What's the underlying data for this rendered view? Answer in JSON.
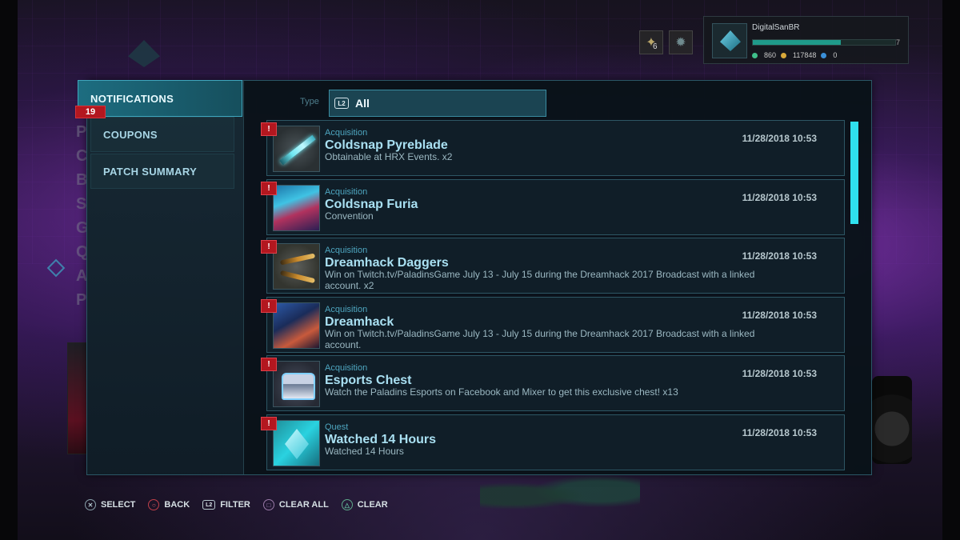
{
  "hud": {
    "badge_count": "6",
    "username": "DigitalSanBR",
    "level": "7",
    "xp_progress": 0.62,
    "stat_a": "860",
    "stat_b": "117848",
    "stat_c": "0"
  },
  "sidebar": {
    "items": [
      {
        "label": "NOTIFICATIONS"
      },
      {
        "label": "COUPONS"
      },
      {
        "label": "PATCH SUMMARY"
      }
    ],
    "notification_count": "19"
  },
  "filter": {
    "type_label": "Type",
    "l2": "L2",
    "value": "All"
  },
  "alert_glyph": "!",
  "notifications": [
    {
      "category": "Acquisition",
      "title": "Coldsnap Pyreblade",
      "desc": "Obtainable at HRX Events. x2",
      "date": "11/28/2018 10:53"
    },
    {
      "category": "Acquisition",
      "title": "Coldsnap Furia",
      "desc": "Convention",
      "date": "11/28/2018 10:53"
    },
    {
      "category": "Acquisition",
      "title": "Dreamhack Daggers",
      "desc": "Win on Twitch.tv/PaladinsGame July 13 - July 15 during the Dreamhack 2017 Broadcast with a linked account. x2",
      "date": "11/28/2018 10:53"
    },
    {
      "category": "Acquisition",
      "title": "Dreamhack",
      "desc": "Win on Twitch.tv/PaladinsGame July 13 - July 15 during the Dreamhack 2017 Broadcast with a linked account.",
      "date": "11/28/2018 10:53"
    },
    {
      "category": "Acquisition",
      "title": "Esports Chest",
      "desc": "Watch the Paladins Esports on Facebook and Mixer to get this exclusive chest! x13",
      "date": "11/28/2018 10:53"
    },
    {
      "category": "Quest",
      "title": "Watched 14 Hours",
      "desc": "Watched 14 Hours",
      "date": "11/28/2018 10:53"
    }
  ],
  "footer": {
    "select": "SELECT",
    "back": "BACK",
    "l2": "L2",
    "filter": "FILTER",
    "clear_all": "CLEAR ALL",
    "clear": "CLEAR"
  },
  "colors": {
    "accent": "#2fe0ee",
    "alert": "#b3171f",
    "active_tab": "#1d6d80"
  }
}
